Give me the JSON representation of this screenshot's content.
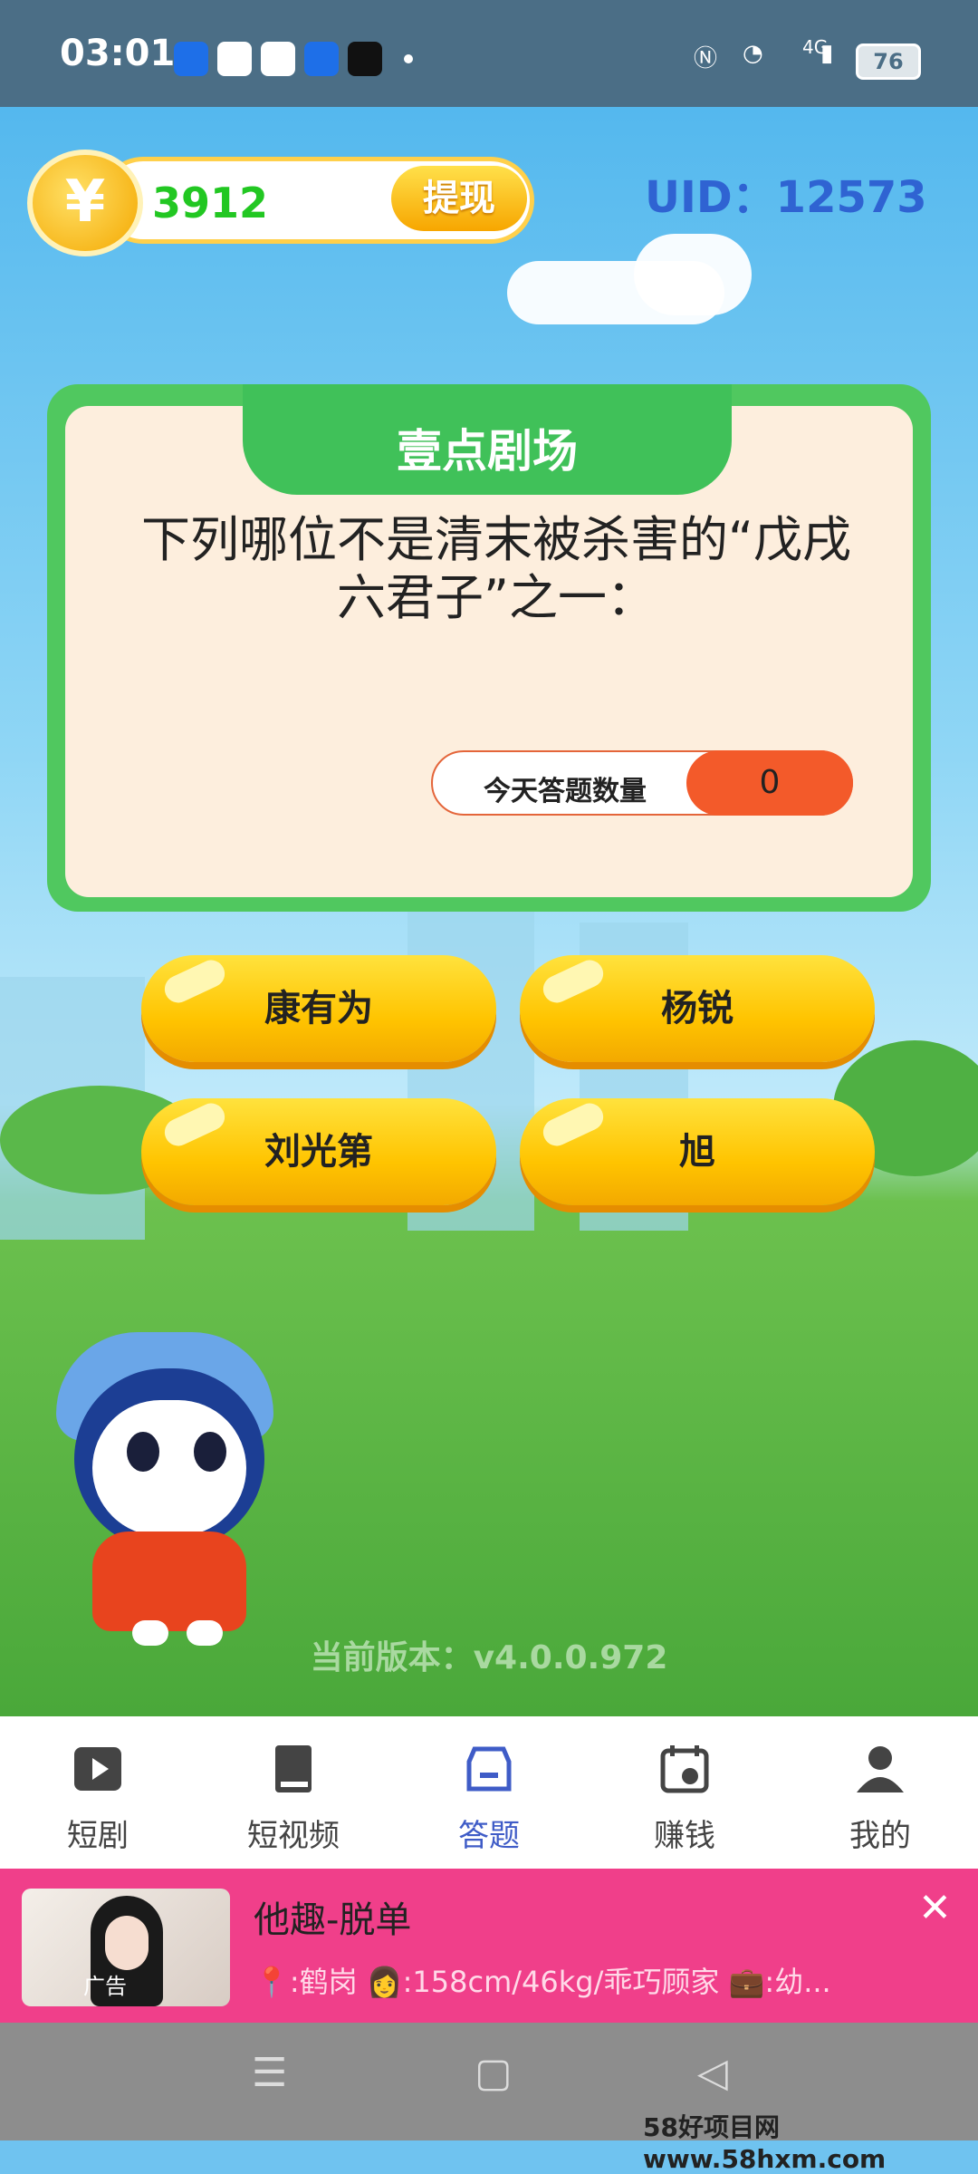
{
  "status_bar": {
    "time": "03:01",
    "network": "4G",
    "battery": "76"
  },
  "header": {
    "coin_symbol": "¥",
    "coins": "3912",
    "withdraw_label": "提现",
    "uid": "UID：12573"
  },
  "card": {
    "title": "壹点剧场",
    "question": "下列哪位不是清末被杀害的“戊戌六君子”之一：",
    "count_label": "今天答题数量",
    "count_value": "0"
  },
  "answers": [
    "康有为",
    "杨锐",
    "刘光第",
    "旭"
  ],
  "version": "当前版本：v4.0.0.972",
  "nav": [
    {
      "label": "短剧",
      "icon": "play-icon"
    },
    {
      "label": "短视频",
      "icon": "book-icon"
    },
    {
      "label": "答题",
      "icon": "store-icon",
      "active": true
    },
    {
      "label": "赚钱",
      "icon": "calendar-coin-icon"
    },
    {
      "label": "我的",
      "icon": "user-icon"
    }
  ],
  "ad": {
    "tag": "广告",
    "title": "他趣-脱单",
    "desc": "📍:鹤岗 👩:158cm/46kg/乖巧顾家 💼:幼...",
    "close": "✕"
  },
  "system_nav": {
    "menu": "☰",
    "home": "▢",
    "back": "◁"
  },
  "watermark": "58好项目网www.58hxm.com",
  "colors": {
    "accent": "#3f5cc7",
    "coin_green": "#22c722",
    "card_green": "#50c85f",
    "ad_pink": "#f03f8a"
  }
}
